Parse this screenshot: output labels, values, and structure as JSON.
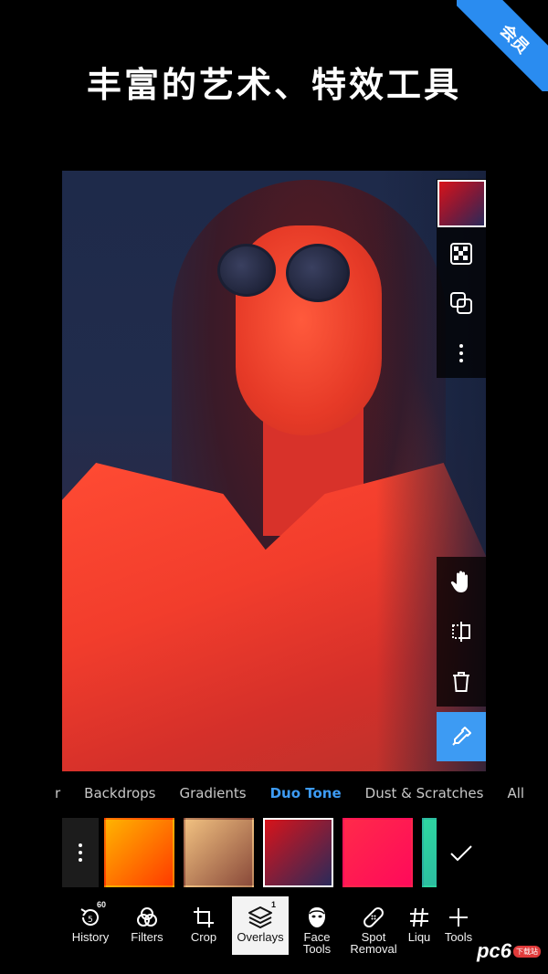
{
  "banner": {
    "ribbon_label": "会员",
    "headline": "丰富的艺术、特效工具"
  },
  "canvas": {
    "side_tools_top": [
      {
        "name": "current-color-swatch",
        "icon": "color-swatch"
      },
      {
        "name": "transparency-toggle",
        "icon": "checkerboard-icon"
      },
      {
        "name": "blend-mode-button",
        "icon": "layers-overlap-icon"
      },
      {
        "name": "more-options-button",
        "icon": "vertical-dots-icon"
      }
    ],
    "side_tools_bottom": [
      {
        "name": "pan-hand-button",
        "icon": "hand-icon"
      },
      {
        "name": "flip-button",
        "icon": "flip-icon"
      },
      {
        "name": "delete-button",
        "icon": "trash-icon"
      }
    ],
    "eyedropper": {
      "icon": "eyedropper-icon",
      "active_color": "#3d9bf3"
    }
  },
  "category_tabs": {
    "cut_off_prefix": "r",
    "items": [
      "Backdrops",
      "Gradients",
      "Duo Tone",
      "Dust & Scratches",
      "All"
    ],
    "active": "Duo Tone"
  },
  "presets": {
    "thumbs": [
      {
        "colors": [
          "#ffb300",
          "#ff3b00"
        ],
        "selected": false
      },
      {
        "colors": [
          "#f0c080",
          "#8a4a3a"
        ],
        "selected": false
      },
      {
        "colors": [
          "#d8131a",
          "#2a2a5a"
        ],
        "selected": true
      },
      {
        "colors": [
          "#ff2a4a",
          "#ff0a5a"
        ],
        "selected": false
      },
      {
        "colors": [
          "#2ed8a0",
          "#2aa8a0"
        ],
        "selected": false
      }
    ],
    "apply_icon": "checkmark-icon"
  },
  "toolbar": {
    "items": [
      {
        "label": "History",
        "icon": "history-icon",
        "badge": "60"
      },
      {
        "label": "Filters",
        "icon": "filters-icon"
      },
      {
        "label": "Crop",
        "icon": "crop-icon"
      },
      {
        "label": "Overlays",
        "icon": "layers-icon",
        "badge": "1",
        "active": true
      },
      {
        "label": "Face Tools",
        "icon": "face-icon"
      },
      {
        "label": "Spot Removal",
        "icon": "bandage-icon"
      },
      {
        "label": "Liqu",
        "icon": "grid-hash-icon"
      },
      {
        "label": "Tools",
        "icon": "plus-icon"
      }
    ]
  },
  "watermark": {
    "logo": "pc6",
    "sub": "下载站"
  }
}
